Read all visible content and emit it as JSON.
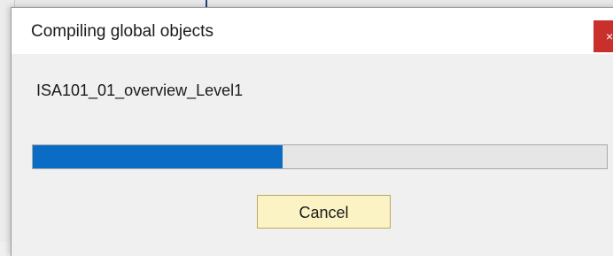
{
  "dialog": {
    "title": "Compiling global objects",
    "close_label": "×",
    "object_name": "ISA101_01_overview_Level1",
    "progress_fraction": 0.435,
    "cancel_label": "Cancel"
  },
  "icons": {
    "close": "close-icon"
  },
  "colors": {
    "progress_fill": "#0a6cc4",
    "close_button": "#c9302c",
    "cancel_button": "#fcf3c4"
  }
}
